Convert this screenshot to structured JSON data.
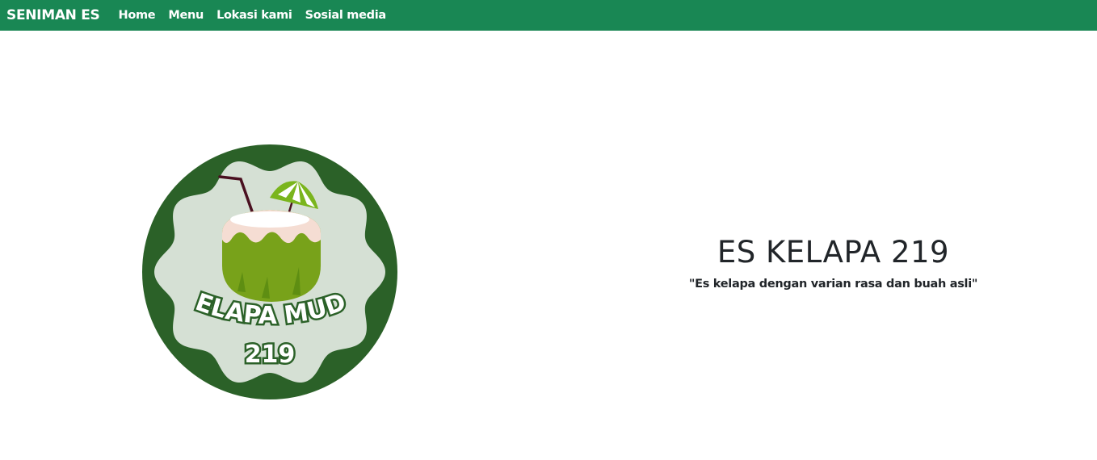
{
  "nav": {
    "brand": "SENIMAN ES",
    "links": [
      "Home",
      "Menu",
      "Lokasi kami",
      "Sosial media"
    ]
  },
  "logo": {
    "line1": "KELAPA MUDA",
    "line2": "219",
    "colors": {
      "ring": "#2b6128",
      "inner": "#d5e0d4",
      "coconut": "#78a21a",
      "flesh": "#f5ddd3"
    }
  },
  "hero": {
    "title": "ES KELAPA 219",
    "tagline": "\"Es kelapa dengan varian rasa dan buah asli\""
  },
  "colors": {
    "navbar": "#198754",
    "text": "#212529"
  }
}
